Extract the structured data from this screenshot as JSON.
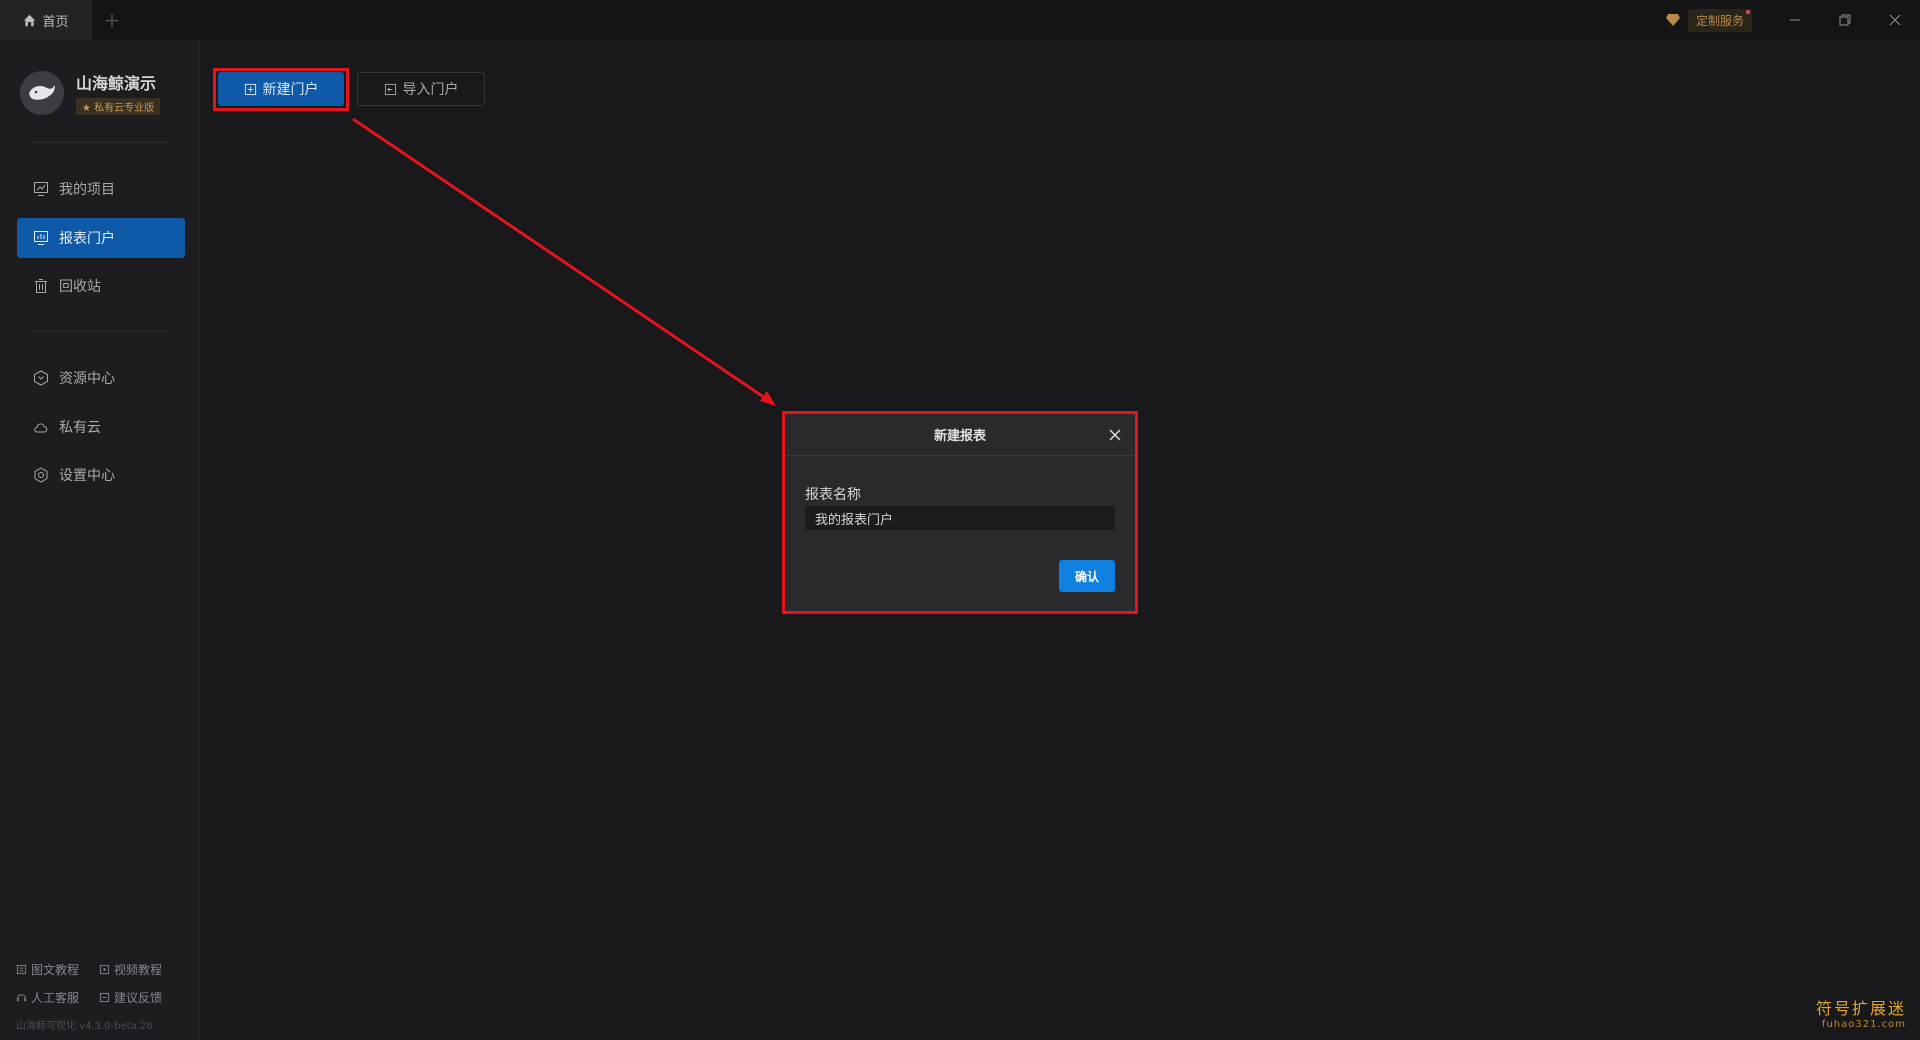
{
  "titlebar": {
    "home_tab": "首页",
    "add_tab": "+",
    "custom_service": "定制服务"
  },
  "sidebar": {
    "brand_name": "山海鲸演示",
    "brand_badge": "★ 私有云专业版",
    "items": [
      {
        "label": "我的项目",
        "icon": "project-icon"
      },
      {
        "label": "报表门户",
        "icon": "portal-icon",
        "active": true
      },
      {
        "label": "回收站",
        "icon": "trash-icon"
      },
      {
        "label": "资源中心",
        "icon": "resource-icon"
      },
      {
        "label": "私有云",
        "icon": "cloud-icon"
      },
      {
        "label": "设置中心",
        "icon": "settings-icon"
      }
    ],
    "footer": {
      "image_tutorial": "图文教程",
      "video_tutorial": "视频教程",
      "customer_service": "人工客服",
      "feedback": "建议反馈",
      "version": "山海鲸可视化 v4.3.0-beta.28"
    }
  },
  "toolbar": {
    "new_portal": "新建门户",
    "import_portal": "导入门户"
  },
  "dialog": {
    "title": "新建报表",
    "field_label": "报表名称",
    "field_value": "我的报表门户",
    "confirm": "确认"
  },
  "watermark": {
    "cn": "符号扩展迷",
    "en": "fuhao321.com"
  },
  "colors": {
    "accent": "#0f5aa8",
    "confirm": "#0f80e0",
    "highlight": "#e3141b"
  }
}
